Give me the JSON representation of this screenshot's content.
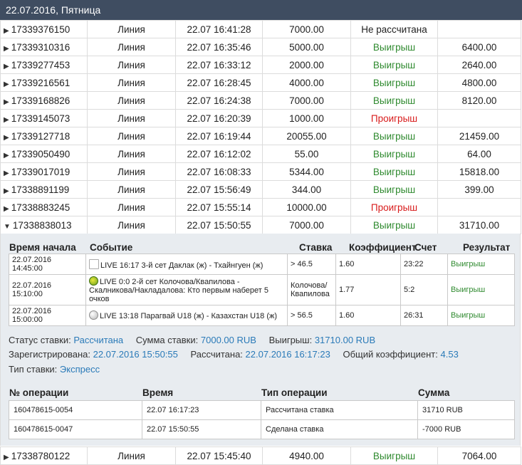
{
  "day_header": "22.07.2016, Пятница",
  "bets": [
    {
      "id": "17339376150",
      "type": "Линия",
      "time": "22.07 16:41:28",
      "stake": "7000.00",
      "result": "Не рассчитана",
      "status": "none",
      "payout": ""
    },
    {
      "id": "17339310316",
      "type": "Линия",
      "time": "22.07 16:35:46",
      "stake": "5000.00",
      "result": "Выигрыш",
      "status": "win",
      "payout": "6400.00"
    },
    {
      "id": "17339277453",
      "type": "Линия",
      "time": "22.07 16:33:12",
      "stake": "2000.00",
      "result": "Выигрыш",
      "status": "win",
      "payout": "2640.00"
    },
    {
      "id": "17339216561",
      "type": "Линия",
      "time": "22.07 16:28:45",
      "stake": "4000.00",
      "result": "Выигрыш",
      "status": "win",
      "payout": "4800.00"
    },
    {
      "id": "17339168826",
      "type": "Линия",
      "time": "22.07 16:24:38",
      "stake": "7000.00",
      "result": "Выигрыш",
      "status": "win",
      "payout": "8120.00"
    },
    {
      "id": "17339145073",
      "type": "Линия",
      "time": "22.07 16:20:39",
      "stake": "1000.00",
      "result": "Проигрыш",
      "status": "lose",
      "payout": ""
    },
    {
      "id": "17339127718",
      "type": "Линия",
      "time": "22.07 16:19:44",
      "stake": "20055.00",
      "result": "Выигрыш",
      "status": "win",
      "payout": "21459.00"
    },
    {
      "id": "17339050490",
      "type": "Линия",
      "time": "22.07 16:12:02",
      "stake": "55.00",
      "result": "Выигрыш",
      "status": "win",
      "payout": "64.00"
    },
    {
      "id": "17339017019",
      "type": "Линия",
      "time": "22.07 16:08:33",
      "stake": "5344.00",
      "result": "Выигрыш",
      "status": "win",
      "payout": "15818.00"
    },
    {
      "id": "17338891199",
      "type": "Линия",
      "time": "22.07 15:56:49",
      "stake": "344.00",
      "result": "Выигрыш",
      "status": "win",
      "payout": "399.00"
    },
    {
      "id": "17338883245",
      "type": "Линия",
      "time": "22.07 15:55:14",
      "stake": "10000.00",
      "result": "Проигрыш",
      "status": "lose",
      "payout": ""
    },
    {
      "id": "17338838013",
      "type": "Линия",
      "time": "22.07 15:50:55",
      "stake": "7000.00",
      "result": "Выигрыш",
      "status": "win",
      "payout": "31710.00",
      "expanded": true
    }
  ],
  "details": {
    "headers": {
      "start_time": "Время начала",
      "event": "Событие",
      "bet": "Ставка",
      "coef": "Коэффициент",
      "score": "Счет",
      "result": "Результат"
    },
    "events": [
      {
        "start": "22.07.2016 14:45:00",
        "icon": "image-placeholder-icon",
        "event": "LIVE 16:17 3-й сет Даклак (ж) - Тхайнгуен (ж)",
        "bet": "> 46.5",
        "coef": "1.60",
        "score": "23:22",
        "result": "Выигрыш"
      },
      {
        "start": "22.07.2016 15:10:00",
        "icon": "tennis-ball-icon",
        "event": "LIVE 0:0 2-й сет Колочова/Квапилова - Скалникова/Накладалова: Кто первым наберет 5 очков",
        "bet": "Колочова/Квапилова",
        "coef": "1.77",
        "score": "5:2",
        "result": "Выигрыш"
      },
      {
        "start": "22.07.2016 15:00:00",
        "icon": "volleyball-icon",
        "event": "LIVE 13:18 Парагвай U18 (ж) - Казахстан U18 (ж)",
        "bet": "> 56.5",
        "coef": "1.60",
        "score": "26:31",
        "result": "Выигрыш"
      }
    ],
    "info": {
      "status_label": "Статус ставки:",
      "status_value": "Рассчитана",
      "sum_label": "Сумма ставки:",
      "sum_value": "7000.00 RUB",
      "win_label": "Выигрыш:",
      "win_value": "31710.00 RUB",
      "registered_label": "Зарегистрирована:",
      "registered_value": "22.07.2016 15:50:55",
      "calculated_label": "Рассчитана:",
      "calculated_value": "22.07.2016 16:17:23",
      "total_coef_label": "Общий коэффициент:",
      "total_coef_value": "4.53",
      "bet_type_label": "Тип ставки:",
      "bet_type_value": "Экспресс"
    },
    "ops_headers": {
      "op_no": "№ операции",
      "time": "Время",
      "op_type": "Тип операции",
      "sum": "Сумма"
    },
    "operations": [
      {
        "no": "160478615-0054",
        "time": "22.07 16:17:23",
        "type": "Рассчитана ставка",
        "sum": "31710 RUB"
      },
      {
        "no": "160478615-0047",
        "time": "22.07 15:50:55",
        "type": "Сделана ставка",
        "sum": "-7000 RUB"
      }
    ]
  },
  "last_bet": {
    "id": "17338780122",
    "type": "Линия",
    "time": "22.07 15:45:40",
    "stake": "4940.00",
    "result": "Выигрыш",
    "status": "win",
    "payout": "7064.00"
  },
  "colors": {
    "header_bg": "#3f4d61",
    "win": "#2f8a2f",
    "lose": "#d81b1b",
    "link": "#2a7ab8",
    "details_bg": "#e8ecf0"
  }
}
